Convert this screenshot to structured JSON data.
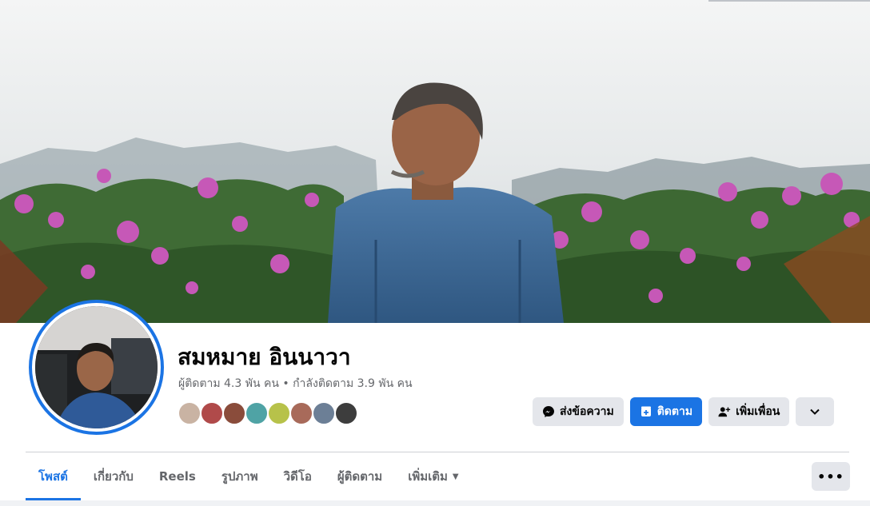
{
  "profile": {
    "name": "สมหมาย อินนาวา",
    "stats": "ผู้ติดตาม 4.3 พัน คน • กำลังติดตาม 3.9 พัน คน"
  },
  "actions": {
    "message_label": "ส่งข้อความ",
    "follow_label": "ติดตาม",
    "add_friend_label": "เพิ่มเพื่อน"
  },
  "tabs": [
    {
      "label": "โพสต์",
      "active": true
    },
    {
      "label": "เกี่ยวกับ"
    },
    {
      "label": "Reels"
    },
    {
      "label": "รูปภาพ"
    },
    {
      "label": "วิดีโอ"
    },
    {
      "label": "ผู้ติดตาม"
    },
    {
      "label": "เพิ่มเติม"
    }
  ],
  "colors": {
    "accent": "#1b74e4",
    "button_grey": "#e4e6eb",
    "secondary_text": "#65676b"
  },
  "icons": [
    "messenger-icon",
    "follow-icon",
    "add-friend-icon",
    "chevron-down-icon",
    "more-options-icon",
    "caret-down-icon"
  ]
}
